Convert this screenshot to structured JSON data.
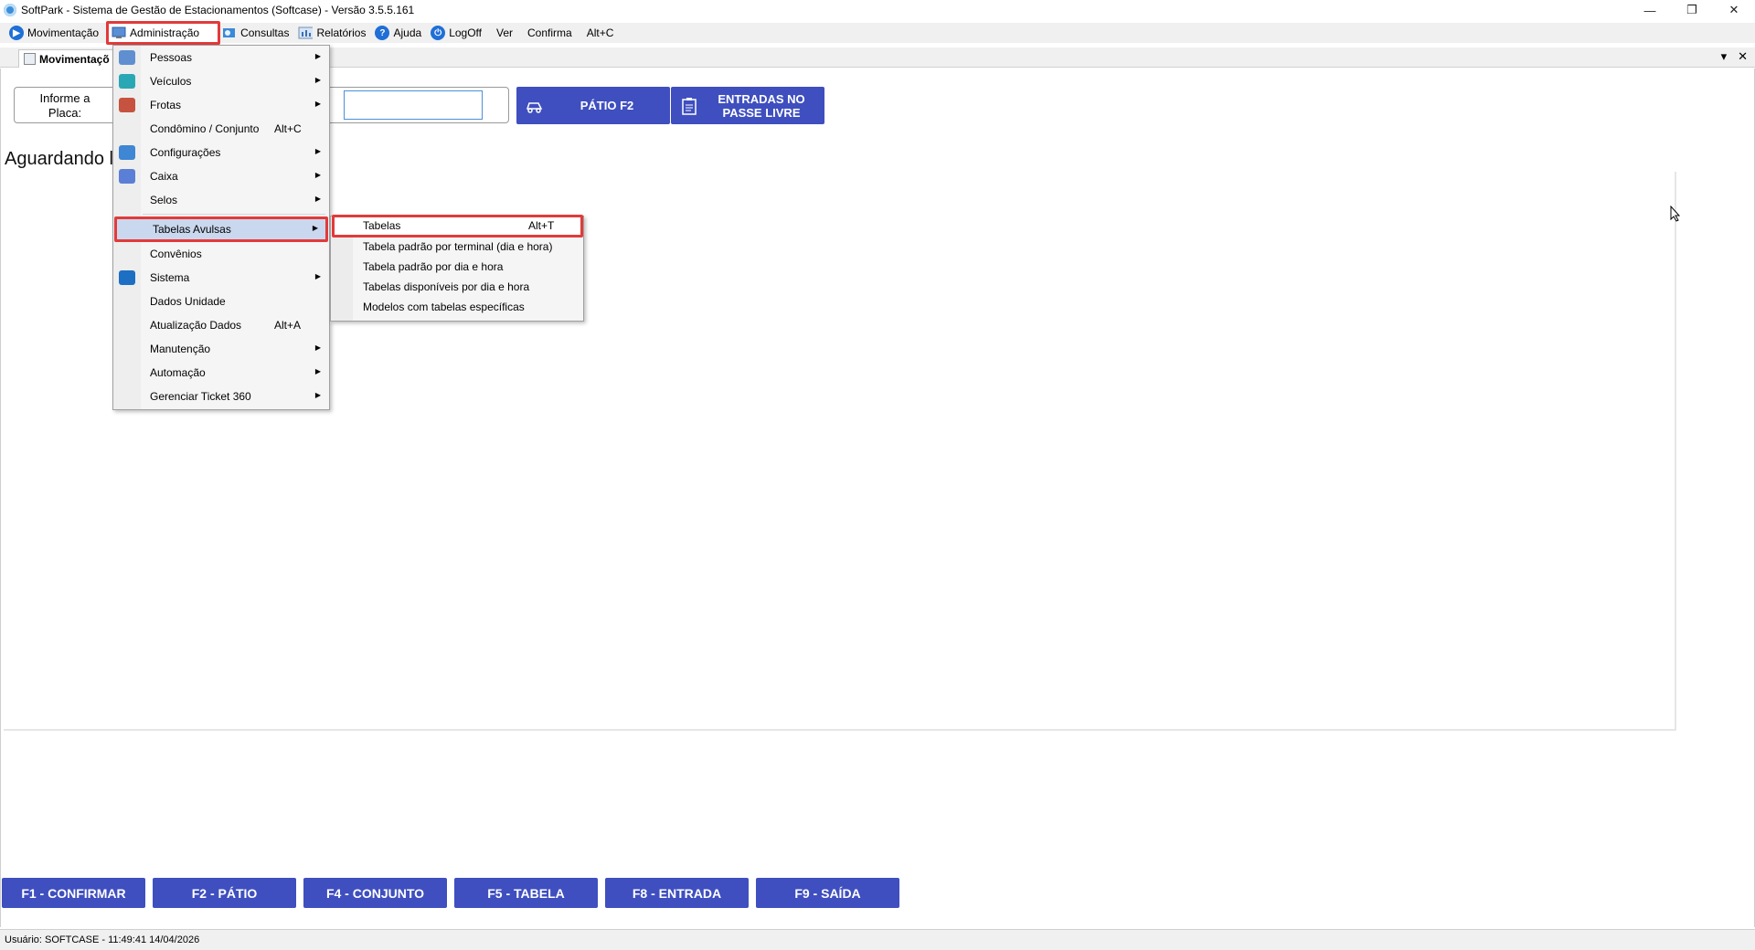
{
  "window": {
    "title": "SoftPark - Sistema de Gestão de Estacionamentos (Softcase) - Versão 3.5.5.161",
    "minimize": "—",
    "restore": "❐",
    "close": "✕"
  },
  "menubar": {
    "items": [
      {
        "label": "Movimentação",
        "icon": "play-icon"
      },
      {
        "label": "Administração",
        "icon": "admin-icon"
      },
      {
        "label": "Consultas",
        "icon": "search-icon"
      },
      {
        "label": "Relatórios",
        "icon": "reports-icon"
      },
      {
        "label": "Ajuda",
        "icon": "help-icon"
      },
      {
        "label": "LogOff",
        "icon": "power-icon"
      },
      {
        "label": "Ver",
        "icon": ""
      },
      {
        "label": "Confirma",
        "icon": ""
      },
      {
        "label": "Alt+C",
        "icon": ""
      }
    ]
  },
  "tab": {
    "label": "Movimentaçõ"
  },
  "tab_controls": {
    "dropdown": "▾",
    "close": "✕"
  },
  "main": {
    "plate_label": "Informe a Placa:",
    "plate_value": "",
    "btn_patio": "PÁTIO F2",
    "btn_livre": "ENTRADAS NO PASSE LIVRE",
    "waiting": "Aguardando l"
  },
  "admin_menu": {
    "items": [
      {
        "label": "Pessoas",
        "shortcut": "",
        "submenu": true,
        "icon": "people-icon",
        "color": "#5f8fd0"
      },
      {
        "label": "Veículos",
        "shortcut": "",
        "submenu": true,
        "icon": "car-icon",
        "color": "#2aa7b5"
      },
      {
        "label": "Frotas",
        "shortcut": "",
        "submenu": true,
        "icon": "fleet-icon",
        "color": "#c6533f"
      },
      {
        "label": "Condômino / Conjunto",
        "shortcut": "Alt+C",
        "submenu": false,
        "icon": "",
        "color": ""
      },
      {
        "label": "Configurações",
        "shortcut": "",
        "submenu": true,
        "icon": "wrench-icon",
        "color": "#3f86d4"
      },
      {
        "label": "Caixa",
        "shortcut": "",
        "submenu": true,
        "icon": "cashier-icon",
        "color": "#5b7fd6"
      },
      {
        "label": "Selos",
        "shortcut": "",
        "submenu": true,
        "icon": "",
        "color": ""
      },
      {
        "label": "Tabelas Avulsas",
        "shortcut": "",
        "submenu": true,
        "icon": "",
        "color": ""
      },
      {
        "label": "Convênios",
        "shortcut": "",
        "submenu": false,
        "icon": "",
        "color": ""
      },
      {
        "label": "Sistema",
        "shortcut": "",
        "submenu": true,
        "icon": "monitor-icon",
        "color": "#1d6fc4"
      },
      {
        "label": "Dados Unidade",
        "shortcut": "",
        "submenu": false,
        "icon": "",
        "color": ""
      },
      {
        "label": "Atualização Dados",
        "shortcut": "Alt+A",
        "submenu": false,
        "icon": "",
        "color": ""
      },
      {
        "label": "Manutenção",
        "shortcut": "",
        "submenu": true,
        "icon": "",
        "color": ""
      },
      {
        "label": "Automação",
        "shortcut": "",
        "submenu": true,
        "icon": "",
        "color": ""
      },
      {
        "label": "Gerenciar Ticket 360",
        "shortcut": "",
        "submenu": true,
        "icon": "",
        "color": ""
      }
    ]
  },
  "tabelas_submenu": {
    "items": [
      {
        "label": "Tabelas",
        "shortcut": "Alt+T"
      },
      {
        "label": "Tabela padrão por terminal (dia e hora)",
        "shortcut": ""
      },
      {
        "label": "Tabela padrão por dia e hora",
        "shortcut": ""
      },
      {
        "label": "Tabelas disponíveis por dia e hora",
        "shortcut": ""
      },
      {
        "label": "Modelos com tabelas específicas",
        "shortcut": ""
      }
    ]
  },
  "fkeys": [
    "F1 - CONFIRMAR",
    "F2 - PÁTIO",
    "F4 - CONJUNTO",
    "F5 - TABELA",
    "F8 - ENTRADA",
    "F9 - SAÍDA"
  ],
  "status": {
    "text": "Usuário:  SOFTCASE - 11:49:41 14/04/2026"
  },
  "colors": {
    "accent_button": "#3f4fbf",
    "highlight_border": "#e23a3a",
    "menu_highlight": "#c9d8ee"
  }
}
